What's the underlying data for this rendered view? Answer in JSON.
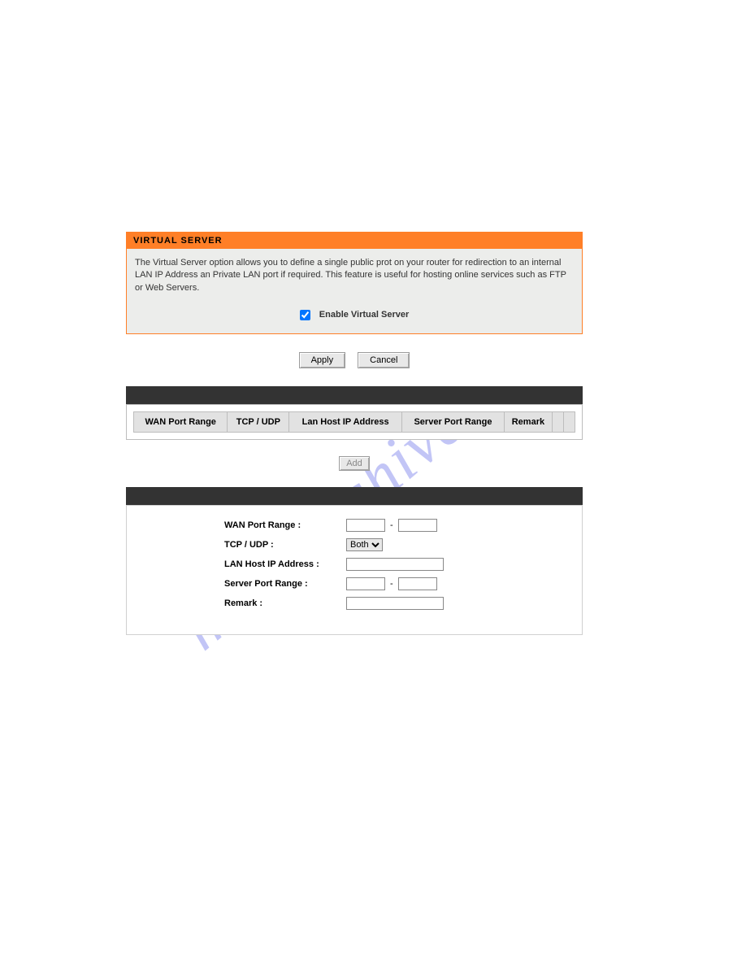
{
  "watermark": "manualshive.com",
  "header": {
    "title": "VIRTUAL SERVER"
  },
  "description": "The Virtual Server option allows you to define a single public prot on your router for redirection to an internal LAN IP Address an Private LAN port if required. This feature is useful for hosting online services such as FTP or Web Servers.",
  "enable": {
    "label": "Enable Virtual Server",
    "checked": true
  },
  "buttons": {
    "apply": "Apply",
    "cancel": "Cancel",
    "add": "Add"
  },
  "table": {
    "headers": {
      "wan_port_range": "WAN Port Range",
      "tcp_udp": "TCP / UDP",
      "lan_host_ip": "Lan Host IP Address",
      "server_port_range": "Server Port Range",
      "remark": "Remark"
    }
  },
  "form": {
    "labels": {
      "wan_port_range": "WAN Port Range  :",
      "tcp_udp": "TCP / UDP :",
      "lan_host_ip": "LAN Host IP Address :",
      "server_port_range": "Server Port Range :",
      "remark": "Remark :"
    },
    "tcp_udp_value": "Both",
    "wan_from": "",
    "wan_to": "",
    "lan_host_ip": "",
    "srv_from": "",
    "srv_to": "",
    "remark": ""
  }
}
